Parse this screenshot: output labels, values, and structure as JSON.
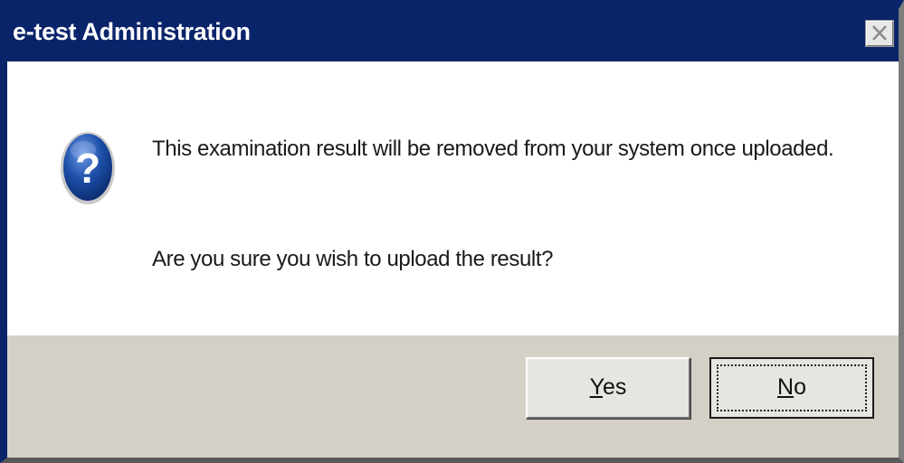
{
  "window": {
    "title": "e-test Administration",
    "close_icon": "close-icon"
  },
  "dialog": {
    "icon": "question-icon",
    "icon_glyph": "?",
    "message_line1": "This examination result will be removed from your system once uploaded.",
    "message_line2": "Are you sure you wish to upload the result?"
  },
  "buttons": {
    "yes": {
      "mnemonic": "Y",
      "rest": "es"
    },
    "no": {
      "mnemonic": "N",
      "rest": "o"
    }
  },
  "colors": {
    "titlebar": "#0a246a",
    "footer": "#d4d0c8",
    "icon_blue": "#1c4fa8"
  }
}
